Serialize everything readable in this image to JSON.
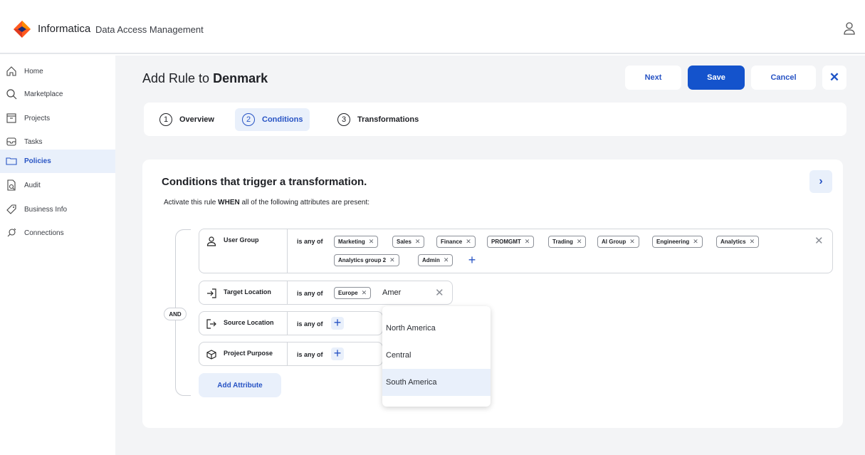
{
  "header": {
    "brand": "Informatica",
    "product": "Data Access Management"
  },
  "sidebar": {
    "items": [
      {
        "label": "Home",
        "icon": "home-icon"
      },
      {
        "label": "Marketplace",
        "icon": "search-icon"
      },
      {
        "label": "Projects",
        "icon": "projects-icon"
      },
      {
        "label": "Tasks",
        "icon": "tasks-icon"
      },
      {
        "label": "Policies",
        "icon": "folder-icon",
        "active": true
      },
      {
        "label": "Audit",
        "icon": "audit-icon"
      },
      {
        "label": "Business Info",
        "icon": "tag-icon"
      },
      {
        "label": "Connections",
        "icon": "connections-icon"
      }
    ]
  },
  "page": {
    "title_prefix": "Add Rule to",
    "title_target": "Denmark"
  },
  "actions": {
    "next": "Next",
    "save": "Save",
    "cancel": "Cancel",
    "close": "✕"
  },
  "steps": [
    {
      "num": "1",
      "label": "Overview"
    },
    {
      "num": "2",
      "label": "Conditions",
      "active": true
    },
    {
      "num": "3",
      "label": "Transformations"
    }
  ],
  "conditions": {
    "title": "Conditions that trigger a transformation.",
    "subtitle_pre": "Activate this rule",
    "subtitle_bold": "WHEN",
    "subtitle_post": "all of the following attributes are present:",
    "logic": "AND",
    "operator": "is any of",
    "rows": [
      {
        "attribute": "User Group",
        "values": [
          "Marketing",
          "Sales",
          "Finance",
          "PROMGMT",
          "Trading",
          "AI Group",
          "Engineering",
          "Analytics",
          "Analytics group 2",
          "Admin"
        ]
      },
      {
        "attribute": "Target Location",
        "values": [
          "Europe"
        ],
        "typed": "Amer"
      },
      {
        "attribute": "Source Location",
        "values": []
      },
      {
        "attribute": "Project Purpose",
        "values": []
      }
    ],
    "add_attribute": "Add Attribute"
  },
  "dropdown": {
    "options": [
      "North America",
      "Central",
      "South America"
    ],
    "highlighted": "South America"
  },
  "colors": {
    "accent": "#1453cc",
    "highlight": "#e9f0fb",
    "logo_orange": "#ff4d00",
    "logo_blue": "#1c2c74"
  }
}
